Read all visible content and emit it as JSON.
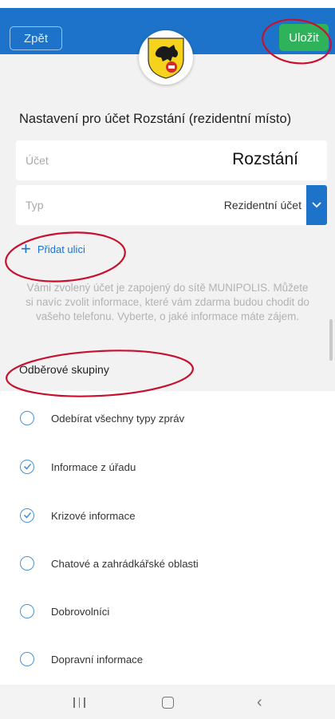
{
  "header": {
    "back_label": "Zpět",
    "save_label": "Uložit"
  },
  "settings": {
    "title": "Nastavení pro účet Rozstání (rezidentní místo)",
    "account": {
      "label": "Účet",
      "value": "Rozstání"
    },
    "type": {
      "label": "Typ",
      "value": "Rezidentní účet"
    },
    "add_street_label": "Přidat ulici",
    "info_lines": [
      "Vámi zvolený účet je zapojený do sítě MUNIPOLIS. Můžete",
      "si navíc zvolit informace, které vám zdarma budou chodit do",
      "vašeho telefonu. Vyberte, o jaké informace máte zájem."
    ]
  },
  "groups": {
    "header": "Odběrové skupiny",
    "items": [
      {
        "label": "Odebírat všechny typy zpráv",
        "checked": false
      },
      {
        "label": "Informace z úřadu",
        "checked": true
      },
      {
        "label": "Krizové informace",
        "checked": true
      },
      {
        "label": "Chatové a zahrádkářské oblasti",
        "checked": false
      },
      {
        "label": "Dobrovolníci",
        "checked": false
      },
      {
        "label": "Dopravní informace",
        "checked": false
      }
    ]
  },
  "colors": {
    "primary": "#1d73c9",
    "save": "#2fb35a",
    "annotation": "#c8102e"
  },
  "icons": {
    "add": "plus-icon",
    "type_dropdown": "chevron-down-icon",
    "logo": "coat-of-arms-icon",
    "nav": [
      "recent-apps-icon",
      "home-icon",
      "back-icon"
    ]
  }
}
